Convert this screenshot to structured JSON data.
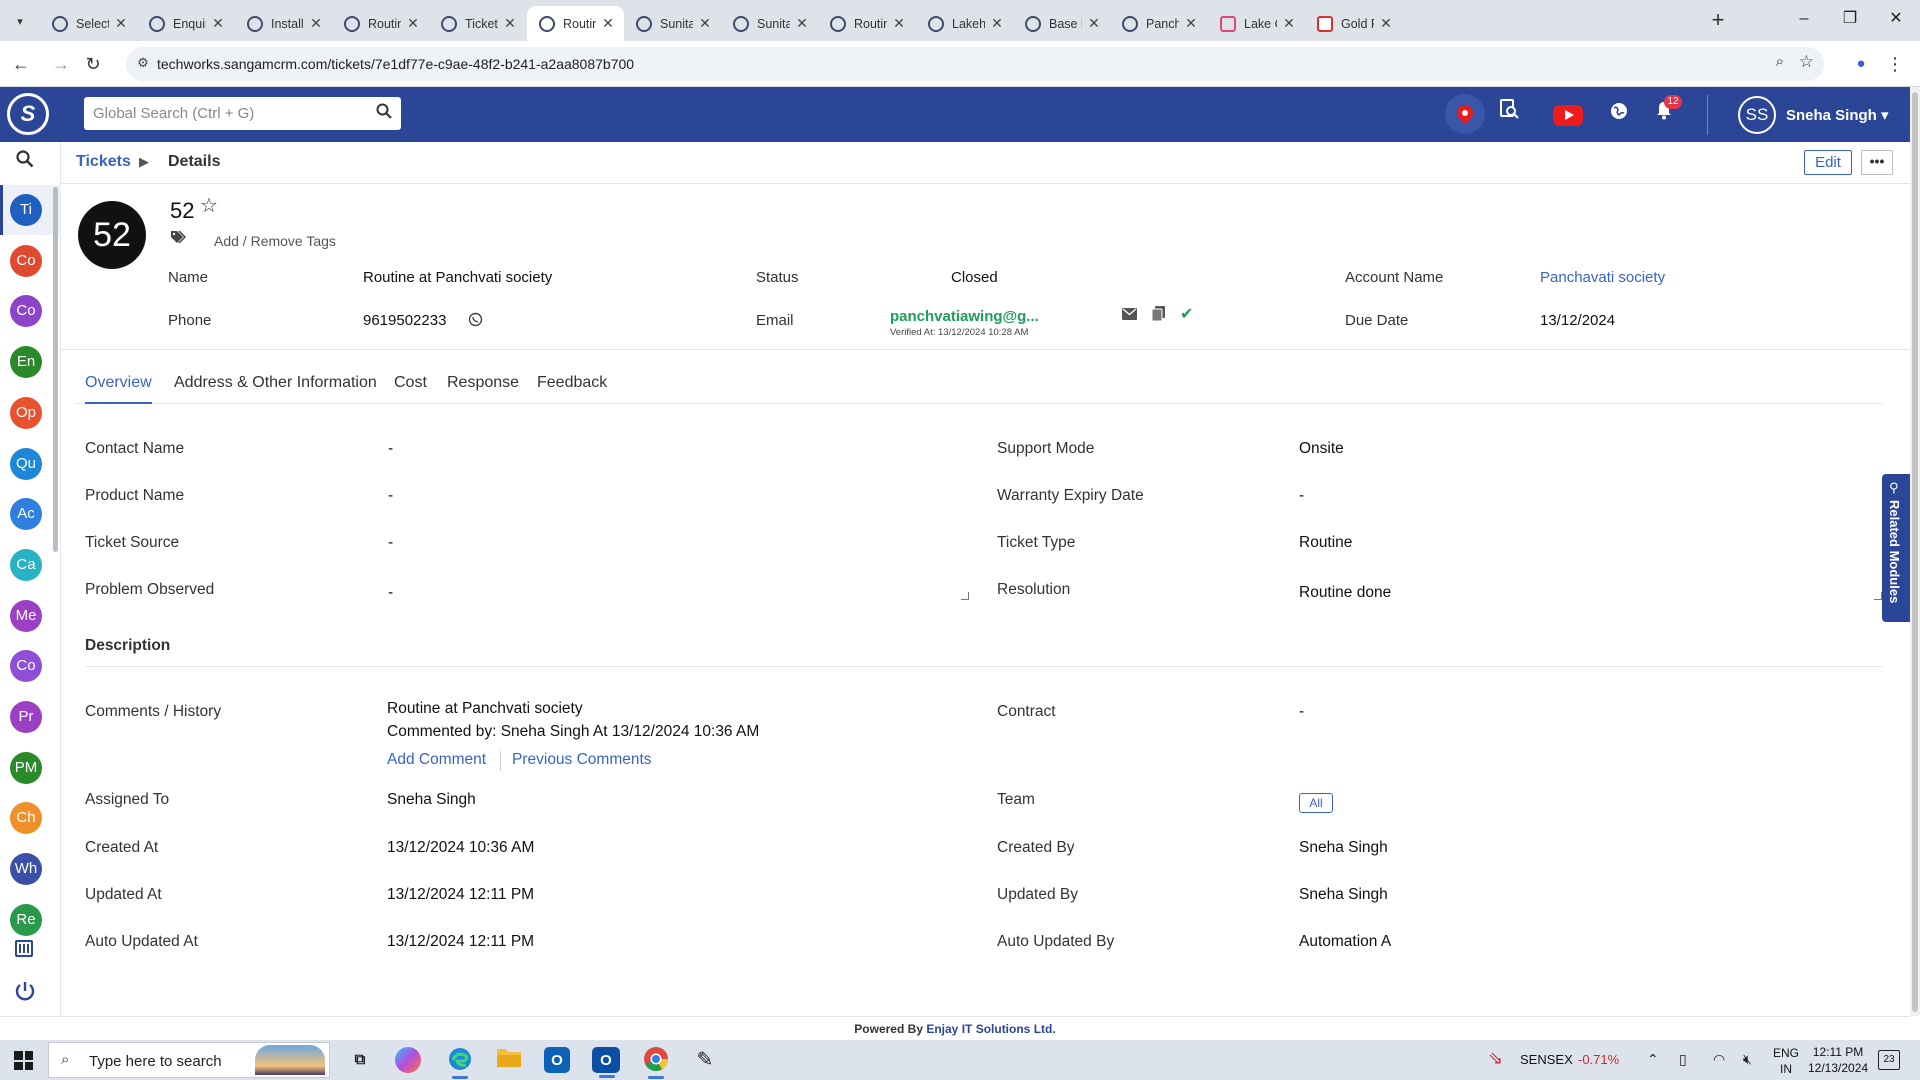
{
  "browser": {
    "tabs": [
      {
        "title": "Selected",
        "icon": "crm-icon"
      },
      {
        "title": "Enquiries",
        "icon": "crm-icon"
      },
      {
        "title": "Installatio",
        "icon": "crm-icon"
      },
      {
        "title": "Routine a",
        "icon": "crm-icon"
      },
      {
        "title": "Tickets Li",
        "icon": "crm-icon"
      },
      {
        "title": "Routine a",
        "icon": "crm-icon",
        "active": true
      },
      {
        "title": "Sunita Ap",
        "icon": "crm-icon"
      },
      {
        "title": "Sunita Ap",
        "icon": "crm-icon"
      },
      {
        "title": "Routine a",
        "icon": "crm-icon"
      },
      {
        "title": "Lakehom",
        "icon": "crm-icon"
      },
      {
        "title": "Base boo",
        "icon": "crm-icon"
      },
      {
        "title": "Panchav",
        "icon": "crm-icon"
      },
      {
        "title": "Lake Club",
        "icon": "heart-icon"
      },
      {
        "title": "Gold Rat",
        "icon": "et-icon"
      }
    ],
    "url": "techworks.sangamcrm.com/tickets/7e1df77e-c9ae-48f2-b241-a2aa8087b700"
  },
  "header": {
    "search_placeholder": "Global Search (Ctrl + G)",
    "notification_count": "12",
    "user_initials": "SS",
    "user_name": "Sneha Singh",
    "brand_color": "#2b4597"
  },
  "sidebar": {
    "items": [
      {
        "abbr": "Ti",
        "color": "#1f5fbf",
        "active": true
      },
      {
        "abbr": "Co",
        "color": "#e04a2f"
      },
      {
        "abbr": "Co",
        "color": "#8e44c9"
      },
      {
        "abbr": "En",
        "color": "#2a8a2a"
      },
      {
        "abbr": "Op",
        "color": "#e8522f"
      },
      {
        "abbr": "Qu",
        "color": "#1e88d8"
      },
      {
        "abbr": "Ac",
        "color": "#2f7fe0"
      },
      {
        "abbr": "Ca",
        "color": "#27b3c4"
      },
      {
        "abbr": "Me",
        "color": "#9b3fc4"
      },
      {
        "abbr": "Co",
        "color": "#8e4fd6"
      },
      {
        "abbr": "Pr",
        "color": "#9b3fc4"
      },
      {
        "abbr": "PM",
        "color": "#2a8a2a"
      },
      {
        "abbr": "Ch",
        "color": "#f0902a"
      },
      {
        "abbr": "Wh",
        "color": "#3a4fa8"
      },
      {
        "abbr": "Re",
        "color": "#2a9a4a"
      }
    ]
  },
  "breadcrumb": {
    "parent": "Tickets",
    "current": "Details"
  },
  "actions": {
    "edit": "Edit",
    "more": "•••"
  },
  "record": {
    "avatar": "52",
    "number": "52",
    "tags_link": "Add / Remove Tags",
    "fields": {
      "name_label": "Name",
      "name_value": "Routine at Panchvati society",
      "status_label": "Status",
      "status_value": "Closed",
      "account_label": "Account Name",
      "account_value": "Panchavati society",
      "phone_label": "Phone",
      "phone_value": "9619502233",
      "email_label": "Email",
      "email_value": "panchvatiawing@g...",
      "email_verified": "Verified At: 13/12/2024 10:28 AM",
      "due_label": "Due Date",
      "due_value": "13/12/2024"
    }
  },
  "tabs": [
    {
      "label": "Overview",
      "active": true
    },
    {
      "label": "Address & Other Information"
    },
    {
      "label": "Cost"
    },
    {
      "label": "Response"
    },
    {
      "label": "Feedback"
    }
  ],
  "overview": {
    "contact_name_label": "Contact Name",
    "contact_name_value": "-",
    "support_mode_label": "Support Mode",
    "support_mode_value": "Onsite",
    "product_name_label": "Product Name",
    "product_name_value": "-",
    "warranty_label": "Warranty Expiry Date",
    "warranty_value": "-",
    "ticket_source_label": "Ticket Source",
    "ticket_source_value": "-",
    "ticket_type_label": "Ticket Type",
    "ticket_type_value": "Routine",
    "problem_label": "Problem Observed",
    "problem_value": "-",
    "resolution_label": "Resolution",
    "resolution_value": "Routine done",
    "description_title": "Description",
    "comments_label": "Comments / History",
    "comment_text": "Routine at Panchvati society",
    "comment_meta": "Commented by: Sneha Singh At 13/12/2024 10:36 AM",
    "add_comment": "Add Comment",
    "previous_comments": "Previous Comments",
    "contract_label": "Contract",
    "contract_value": "-",
    "assigned_label": "Assigned To",
    "assigned_value": "Sneha Singh",
    "team_label": "Team",
    "team_value": "All",
    "created_at_label": "Created At",
    "created_at_value": "13/12/2024 10:36 AM",
    "created_by_label": "Created By",
    "created_by_value": "Sneha Singh",
    "updated_at_label": "Updated At",
    "updated_at_value": "13/12/2024 12:11 PM",
    "updated_by_label": "Updated By",
    "updated_by_value": "Sneha Singh",
    "auto_updated_at_label": "Auto Updated At",
    "auto_updated_at_value": "13/12/2024 12:11 PM",
    "auto_updated_by_label": "Auto Updated By",
    "auto_updated_by_value": "Automation A"
  },
  "related_modules": "Related Modules",
  "footer": {
    "prefix": "Powered By",
    "brand": "Enjay IT Solutions Ltd."
  },
  "taskbar": {
    "search_placeholder": "Type here to search",
    "sensex_label": "SENSEX",
    "sensex_change": "-0.71%",
    "lang_line1": "ENG",
    "lang_line2": "IN",
    "time": "12:11 PM",
    "date": "12/13/2024",
    "notifications": "23"
  }
}
